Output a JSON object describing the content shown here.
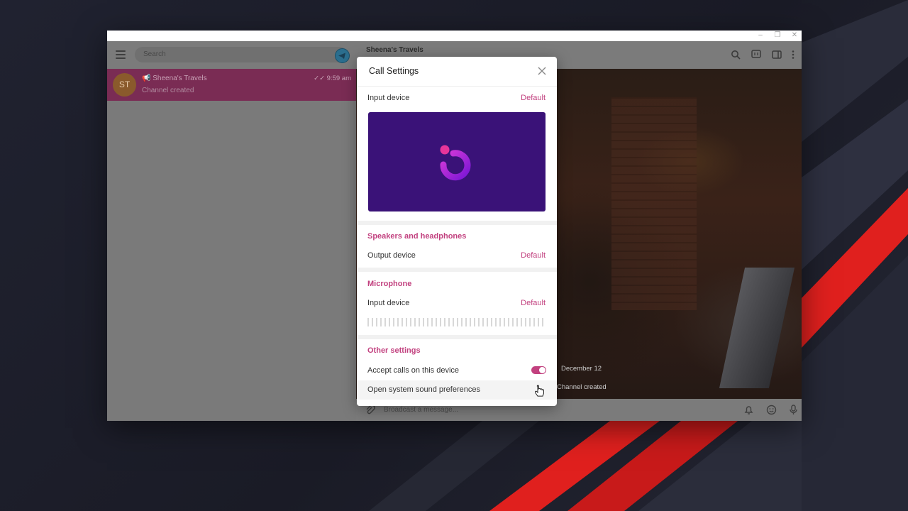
{
  "window": {
    "controls": [
      "minimize",
      "restore",
      "close"
    ]
  },
  "sidebar": {
    "search_placeholder": "Search",
    "chats": [
      {
        "avatar_initials": "ST",
        "name": "Sheena's Travels",
        "preview": "Channel created",
        "time": "9:59 am",
        "selected": true
      }
    ]
  },
  "chat": {
    "title": "Sheena's Travels",
    "date_label": "December 12",
    "service_message": "Channel created",
    "composer_placeholder": "Broadcast a message..."
  },
  "call_settings": {
    "title": "Call Settings",
    "camera": {
      "label": "Input device",
      "value": "Default"
    },
    "speakers": {
      "section_title": "Speakers and headphones",
      "label": "Output device",
      "value": "Default"
    },
    "microphone": {
      "section_title": "Microphone",
      "label": "Input device",
      "value": "Default",
      "level": 0
    },
    "other": {
      "section_title": "Other settings",
      "accept_calls_label": "Accept calls on this device",
      "accept_calls_enabled": true,
      "open_sound_prefs_label": "Open system sound preferences"
    }
  },
  "colors": {
    "accent": "#c2417f",
    "camera_preview_bg": "#3a1278",
    "selected_chat_bg": "#7a2c54"
  }
}
